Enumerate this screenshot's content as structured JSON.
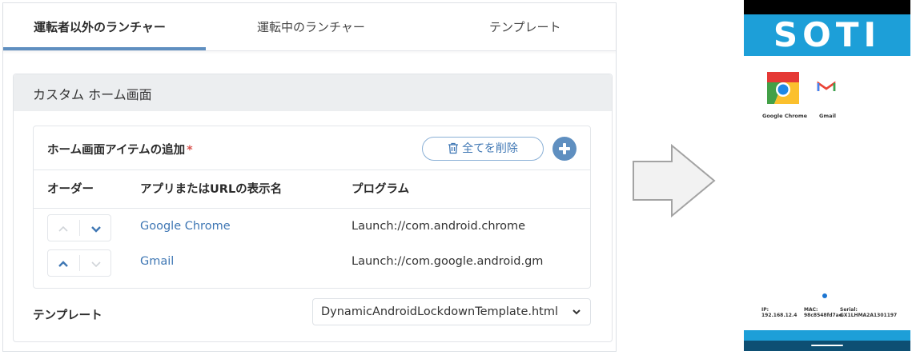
{
  "tabs": [
    {
      "label": "運転者以外のランチャー",
      "active": true
    },
    {
      "label": "運転中のランチャー",
      "active": false
    },
    {
      "label": "テンプレート",
      "active": false
    }
  ],
  "card": {
    "title": "カスタム ホーム画面"
  },
  "home_items": {
    "title": "ホーム画面アイテムの追加",
    "required_mark": "*",
    "delete_all_label": "全てを削除",
    "columns": [
      "オーダー",
      "アプリまたはURLの表示名",
      "プログラム"
    ],
    "rows": [
      {
        "name": "Google Chrome",
        "program": "Launch://com.android.chrome"
      },
      {
        "name": "Gmail",
        "program": "Launch://com.google.android.gm"
      }
    ]
  },
  "template": {
    "label": "テンプレート",
    "selected": "DynamicAndroidLockdownTemplate.html"
  },
  "phone": {
    "brand": "SOTI",
    "apps": [
      {
        "label": "Google Chrome",
        "icon": "chrome-icon"
      },
      {
        "label": "Gmail",
        "icon": "gmail-icon"
      }
    ],
    "info": {
      "ip_label": "IP:",
      "ip_value": "192.168.12.4",
      "mac_label": "MAC:",
      "mac_value": "98c8548fd7ae",
      "serial_label": "Serial:",
      "serial_value": "GX1LHMA2A1301197"
    }
  },
  "colors": {
    "accent": "#5f8fc0",
    "link": "#3f77b4",
    "required": "#d9534f",
    "soti_blue": "#1d9fd8"
  }
}
